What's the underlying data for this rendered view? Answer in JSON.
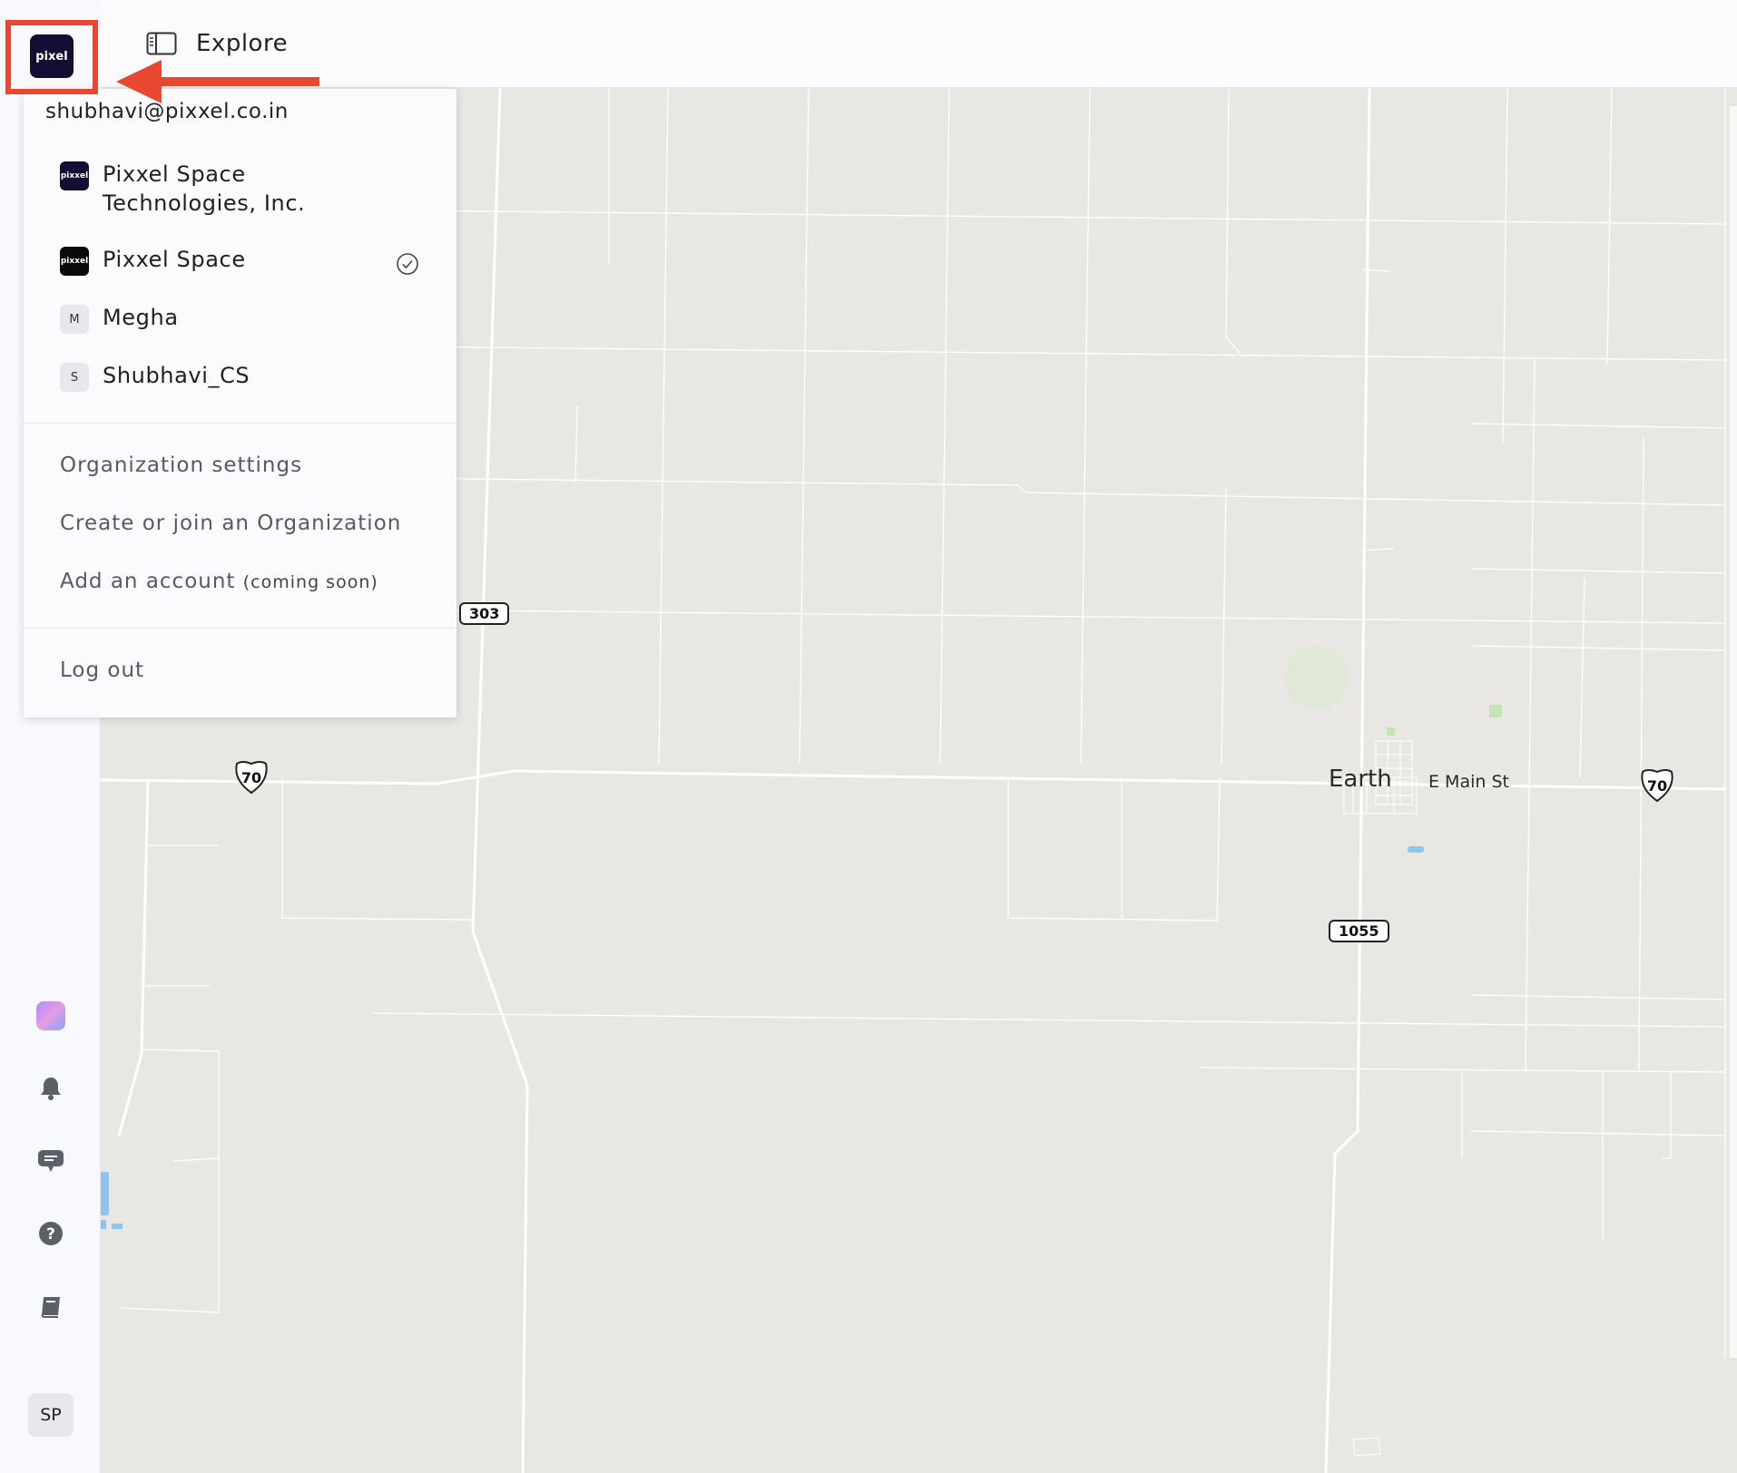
{
  "topbar": {
    "title": "Explore"
  },
  "logo": {
    "text": "pixel"
  },
  "account": {
    "email": "shubhavi@pixxel.co.in",
    "organizations": [
      {
        "name": "Pixxel Space Technologies, Inc.",
        "badge": "pixxel",
        "selected": true
      },
      {
        "name": "Pixxel Space",
        "badge": "pixxel",
        "selected": false
      },
      {
        "name": "Megha",
        "badge": "M",
        "selected": false
      },
      {
        "name": "Shubhavi_CS",
        "badge": "S",
        "selected": false
      }
    ],
    "menu": {
      "org_settings": "Organization settings",
      "create_join": "Create or join an Organization",
      "add_account": "Add an account",
      "add_account_note": "(coming soon)",
      "logout": "Log out"
    }
  },
  "user": {
    "initials": "SP"
  },
  "map": {
    "place": "Earth",
    "street": "E Main St",
    "routes": {
      "state_303": "303",
      "farm_1055": "1055",
      "us_70_west": "70",
      "us_70_east": "70"
    }
  },
  "colors": {
    "highlight": "#e84830",
    "logo_bg": "#140d34",
    "map_bg": "#e8e7e3"
  }
}
